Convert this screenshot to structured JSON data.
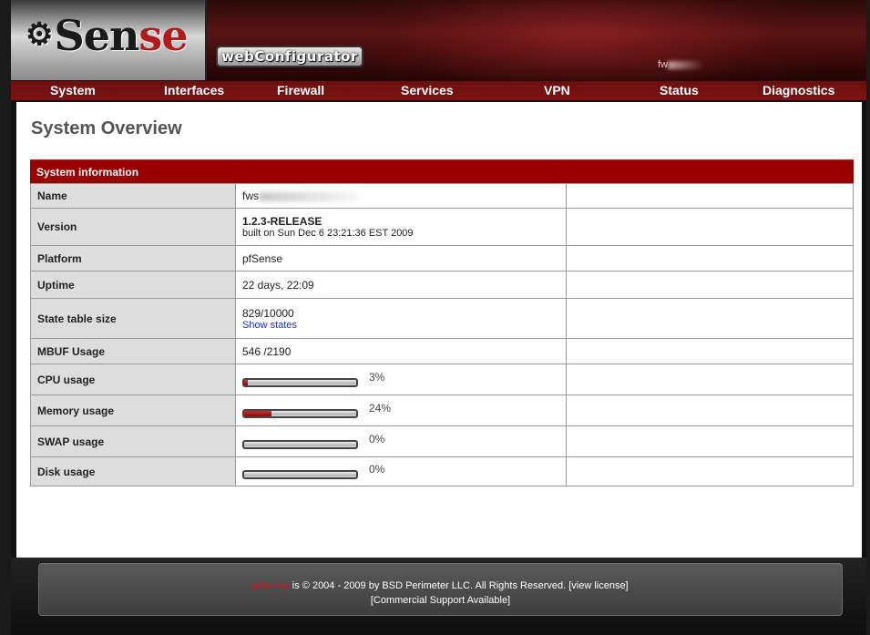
{
  "header": {
    "logo_prefix": "pf",
    "logo_main": "Sen",
    "logo_accent": "se",
    "logo_gear_icon": "gear-cluster-icon",
    "badge": "webConfigurator",
    "hostname_prefix": "fw"
  },
  "nav": [
    "System",
    "Interfaces",
    "Firewall",
    "Services",
    "VPN",
    "Status",
    "Diagnostics"
  ],
  "page": {
    "title": "System Overview"
  },
  "panel": {
    "title": "System information",
    "rows": {
      "name": {
        "label": "Name",
        "value": "fws"
      },
      "version": {
        "label": "Version",
        "value": "1.2.3-RELEASE",
        "built": "built on Sun Dec 6 23:21:36 EST 2009"
      },
      "platform": {
        "label": "Platform",
        "value": "pfSense"
      },
      "uptime": {
        "label": "Uptime",
        "value": "22 days, 22:09"
      },
      "state_table": {
        "label": "State table size",
        "value": "829/10000",
        "link": "Show states"
      },
      "mbuf": {
        "label": "MBUF Usage",
        "value": "546 /2190"
      },
      "cpu": {
        "label": "CPU usage",
        "percent_text": "3%",
        "percent": 3
      },
      "memory": {
        "label": "Memory usage",
        "percent_text": "24%",
        "percent": 24
      },
      "swap": {
        "label": "SWAP usage",
        "percent_text": "0%",
        "percent": 0
      },
      "disk": {
        "label": "Disk usage",
        "percent_text": "0%",
        "percent": 0
      }
    }
  },
  "footer": {
    "brand": "pfSense",
    "copyright": " is © 2004 - 2009 by BSD Perimeter LLC. All Rights Reserved. ",
    "license_link": "[view license]",
    "support_link": "[Commercial Support Available]"
  },
  "colors": {
    "accent_red": "#990000",
    "nav_red": "#7d1212",
    "bar_fill": "#b01c1c"
  }
}
